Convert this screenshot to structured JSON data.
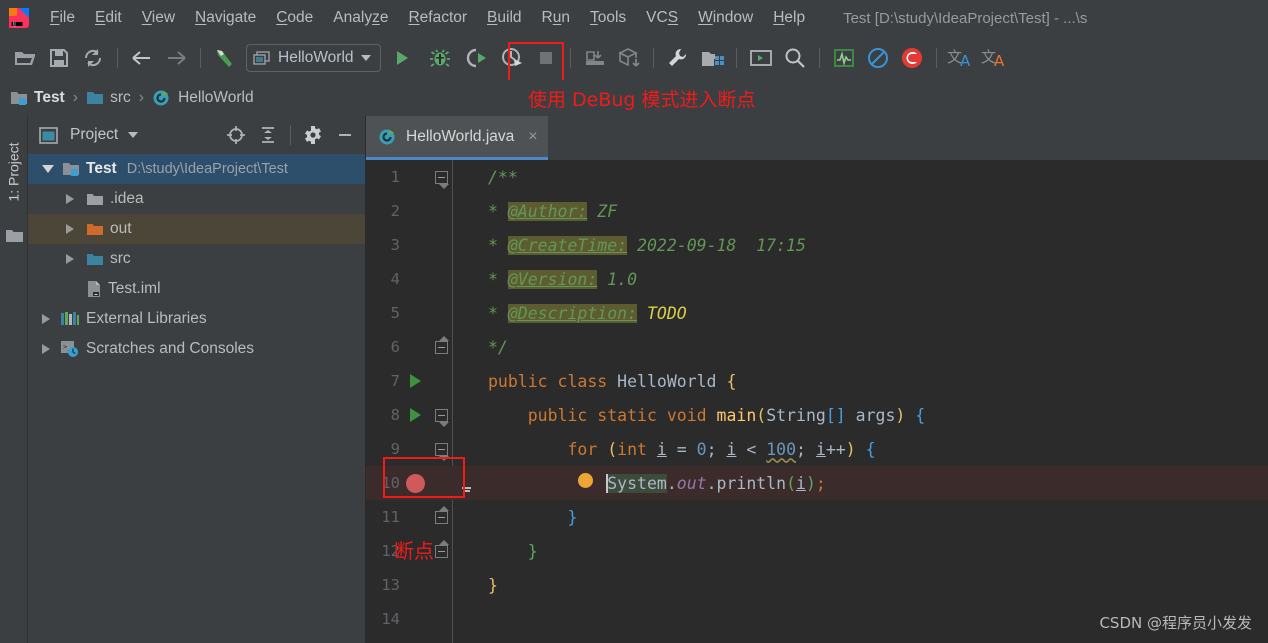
{
  "window": {
    "title": "Test [D:\\study\\IdeaProject\\Test] - ...\\s",
    "logo_icon": "intellij-idea-logo"
  },
  "menubar": {
    "items": [
      {
        "label": "File",
        "mnemonic": "F"
      },
      {
        "label": "Edit",
        "mnemonic": "E"
      },
      {
        "label": "View",
        "mnemonic": "V"
      },
      {
        "label": "Navigate",
        "mnemonic": "N"
      },
      {
        "label": "Code",
        "mnemonic": "C"
      },
      {
        "label": "Analyze",
        "mnemonic": "z"
      },
      {
        "label": "Refactor",
        "mnemonic": "R"
      },
      {
        "label": "Build",
        "mnemonic": "B"
      },
      {
        "label": "Run",
        "mnemonic": "u"
      },
      {
        "label": "Tools",
        "mnemonic": "T"
      },
      {
        "label": "VCS",
        "mnemonic": "S"
      },
      {
        "label": "Window",
        "mnemonic": "W"
      },
      {
        "label": "Help",
        "mnemonic": "H"
      }
    ]
  },
  "toolbar": {
    "open_label": "open-project",
    "save_label": "save-all",
    "sync_label": "sync",
    "back_label": "navigate-back",
    "forward_label": "navigate-forward",
    "build_label": "build-project",
    "run_config": "HelloWorld",
    "run_label": "run",
    "debug_label": "debug",
    "run_coverage_label": "run-with-coverage",
    "profile_label": "profile",
    "stop_label": "stop",
    "update_label": "update-project",
    "commit_label": "commit",
    "settings_label": "settings",
    "project_structure_label": "project-structure",
    "terminal_label": "terminal",
    "search_label": "search-everywhere",
    "monitor_label": "monitor",
    "noop_label": "disable-inspections",
    "c_label": "c-tool",
    "translate1_label": "translate-blue",
    "translate2_label": "translate-orange"
  },
  "annotations": {
    "debug_hint": "使用 DeBug 模式进入断点",
    "breakpoint_hint": "断点",
    "accent_color": "#ee1b1b"
  },
  "breadcrumb": {
    "items": [
      {
        "label": "Test",
        "icon": "project-module-icon"
      },
      {
        "label": "src",
        "icon": "source-folder-icon"
      },
      {
        "label": "HelloWorld",
        "icon": "java-class-icon"
      }
    ],
    "separator": "›"
  },
  "left_strip": {
    "tool_tab": "1: Project",
    "bottom_icon": "folder-icon"
  },
  "project_panel": {
    "title": "Project",
    "buttons": [
      "locate-icon",
      "collapse-all-icon",
      "gear-icon",
      "minimize-icon"
    ],
    "tree": [
      {
        "label": "Test",
        "detail": "D:\\study\\IdeaProject\\Test",
        "icon": "project-module-icon",
        "expanded": true,
        "depth": 0,
        "state": "selected"
      },
      {
        "label": ".idea",
        "detail": "",
        "icon": "folder-gray-icon",
        "expanded": false,
        "depth": 1,
        "state": "normal"
      },
      {
        "label": "out",
        "detail": "",
        "icon": "folder-orange-icon",
        "expanded": false,
        "depth": 1,
        "state": "hover"
      },
      {
        "label": "src",
        "detail": "",
        "icon": "folder-blue-icon",
        "expanded": false,
        "depth": 1,
        "state": "normal"
      },
      {
        "label": "Test.iml",
        "detail": "",
        "icon": "iml-file-icon",
        "expanded": null,
        "depth": 1,
        "state": "normal"
      },
      {
        "label": "External Libraries",
        "detail": "",
        "icon": "libraries-icon",
        "expanded": false,
        "depth": 0,
        "state": "normal"
      },
      {
        "label": "Scratches and Consoles",
        "detail": "",
        "icon": "scratches-icon",
        "expanded": false,
        "depth": 0,
        "state": "normal"
      }
    ]
  },
  "editor": {
    "tab": {
      "label": "HelloWorld.java",
      "icon": "java-class-icon",
      "close": "×"
    },
    "lines": [
      {
        "n": "1"
      },
      {
        "n": "2"
      },
      {
        "n": "3"
      },
      {
        "n": "4"
      },
      {
        "n": "5"
      },
      {
        "n": "6"
      },
      {
        "n": "7"
      },
      {
        "n": "8"
      },
      {
        "n": "9"
      },
      {
        "n": "10"
      },
      {
        "n": "11"
      },
      {
        "n": "12"
      },
      {
        "n": "13"
      },
      {
        "n": "14"
      }
    ],
    "code": {
      "l1": "/**",
      "l2_star": "*",
      "l2_tag": "@Author:",
      "l2_val": "ZF",
      "l3_tag": "@CreateTime:",
      "l3_val": "2022-09-18  17:15",
      "l4_tag": "@Version:",
      "l4_val": "1.0",
      "l5_tag": "@Description:",
      "l5_val": "TODO",
      "l6": "*/",
      "l7_kw1": "public",
      "l7_kw2": "class",
      "l7_name": "HelloWorld",
      "l7_brace": "{",
      "l8_kw1": "public",
      "l8_kw2": "static",
      "l8_kw3": "void",
      "l8_name": "main",
      "l8_type": "String",
      "l8_arr": "[]",
      "l8_arg": "args",
      "l8_brace": "{",
      "l9_kw": "for",
      "l9_kwint": "int",
      "l9_i": "i",
      "l9_zero": "0",
      "l9_limit": "100",
      "l9_inc": "i",
      "l9_brace": "{",
      "l10_sys": "System",
      "l10_out": "out",
      "l10_println": "println",
      "l10_arg": "i",
      "l11_brace": "}",
      "l12_brace": "}",
      "l13_brace": "}"
    },
    "breakpoint_line": "10",
    "gutter": {
      "run_marker": "run-gutter-icon",
      "breakpoint": "breakpoint-icon",
      "intention_bulb": "intention-bulb-icon"
    }
  },
  "watermark": "CSDN @程序员小发发"
}
